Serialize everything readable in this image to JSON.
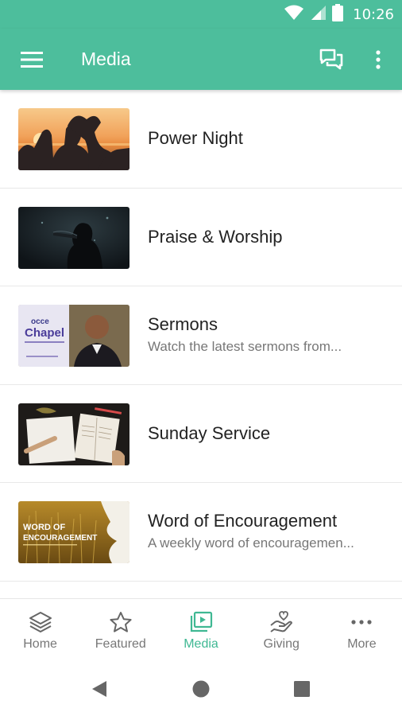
{
  "status_bar": {
    "time": "10:26",
    "icons": [
      "wifi-icon",
      "signal-icon",
      "battery-icon"
    ]
  },
  "app_bar": {
    "title": "Media",
    "menu_icon": "hamburger-menu-icon",
    "chat_icon": "chat-icon",
    "overflow_icon": "more-vert-icon"
  },
  "media_items": [
    {
      "title": "Power Night",
      "subtitle": ""
    },
    {
      "title": "Praise & Worship",
      "subtitle": ""
    },
    {
      "title": "Sermons",
      "subtitle": "Watch the latest sermons from..."
    },
    {
      "title": "Sunday Service",
      "subtitle": ""
    },
    {
      "title": "Word of Encouragement",
      "subtitle": "A weekly word of encouragemen..."
    }
  ],
  "thumb_text": {
    "sermons_sign_line1": "occe",
    "sermons_sign_line2": "Chapel",
    "woe_line1": "WORD OF",
    "woe_line2": "ENCOURAGEMENT"
  },
  "bottom_nav": [
    {
      "label": "Home",
      "icon": "layers-icon",
      "active": false
    },
    {
      "label": "Featured",
      "icon": "star-icon",
      "active": false
    },
    {
      "label": "Media",
      "icon": "video-library-icon",
      "active": true
    },
    {
      "label": "Giving",
      "icon": "giving-hand-icon",
      "active": false
    },
    {
      "label": "More",
      "icon": "more-horiz-icon",
      "active": false
    }
  ],
  "system_nav": {
    "back_icon": "back-icon",
    "home_icon": "home-circle-icon",
    "recents_icon": "recents-icon"
  },
  "colors": {
    "primary": "#4dbe9c",
    "active_nav": "#3fb893",
    "nav_inactive": "#777777",
    "text": "#222222",
    "subtext": "#777777"
  }
}
